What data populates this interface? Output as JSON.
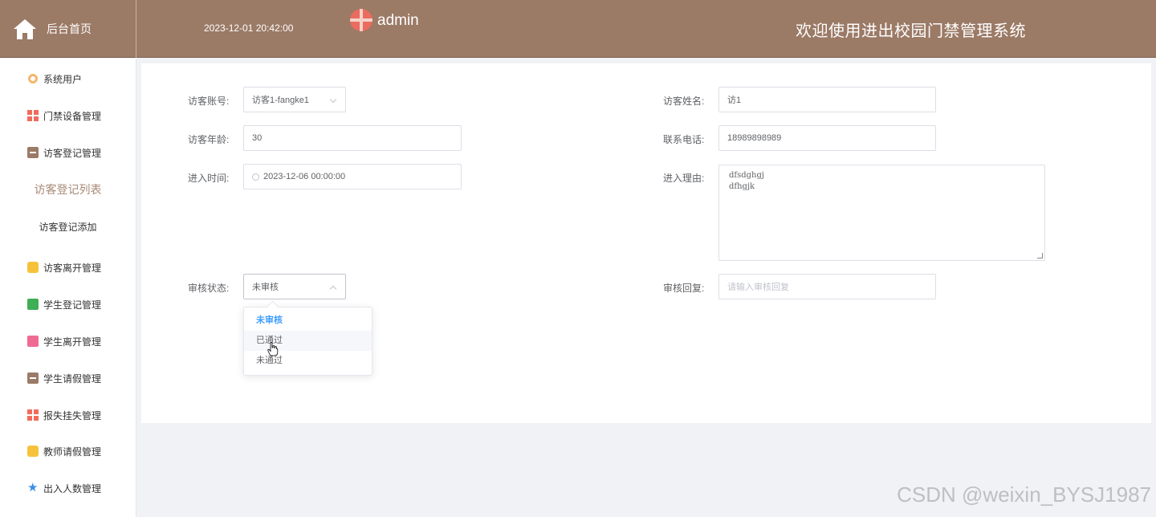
{
  "header": {
    "home_label": "后台首页",
    "datetime": "2023-12-01 20:42:00",
    "username": "admin",
    "system_title": "欢迎使用进出校园门禁管理系统"
  },
  "sidebar": {
    "items": [
      {
        "label": "系统用户",
        "icon": "gear-icon"
      },
      {
        "label": "门禁设备管理",
        "icon": "grid-icon"
      },
      {
        "label": "访客登记管理",
        "icon": "box-icon"
      },
      {
        "label": "访客登记列表",
        "icon": "",
        "active": true
      },
      {
        "label": "访客登记添加",
        "icon": ""
      },
      {
        "label": "访客离开管理",
        "icon": "cube-icon"
      },
      {
        "label": "学生登记管理",
        "icon": "chat-icon"
      },
      {
        "label": "学生离开管理",
        "icon": "bag-icon"
      },
      {
        "label": "学生请假管理",
        "icon": "box-icon"
      },
      {
        "label": "报失挂失管理",
        "icon": "grid-icon"
      },
      {
        "label": "教师请假管理",
        "icon": "cube-icon"
      },
      {
        "label": "出入人数管理",
        "icon": "star-icon"
      }
    ]
  },
  "form": {
    "visitor_account_label": "访客账号:",
    "visitor_account_value": "访客1-fangke1",
    "visitor_name_label": "访客姓名:",
    "visitor_name_value": "访1",
    "visitor_age_label": "访客年龄:",
    "visitor_age_value": "30",
    "phone_label": "联系电话:",
    "phone_value": "18989898989",
    "entry_time_label": "进入时间:",
    "entry_time_value": "2023-12-06 00:00:00",
    "entry_reason_label": "进入理由:",
    "entry_reason_line1": "dfsdghgj",
    "entry_reason_line2": "dfhgjk",
    "review_status_label": "审核状态:",
    "review_status_value": "未审核",
    "review_reply_label": "审核回复:",
    "review_reply_placeholder": "请输入审核回复"
  },
  "dropdown": {
    "options": [
      "未审核",
      "已通过",
      "未通过"
    ],
    "selected": "未审核",
    "hovered": "已通过"
  },
  "watermark": "CSDN @weixin_BYSJ1987",
  "colors": {
    "header_bg": "#9b7a66",
    "active_menu": "#a88976",
    "selected_option": "#409eff"
  }
}
